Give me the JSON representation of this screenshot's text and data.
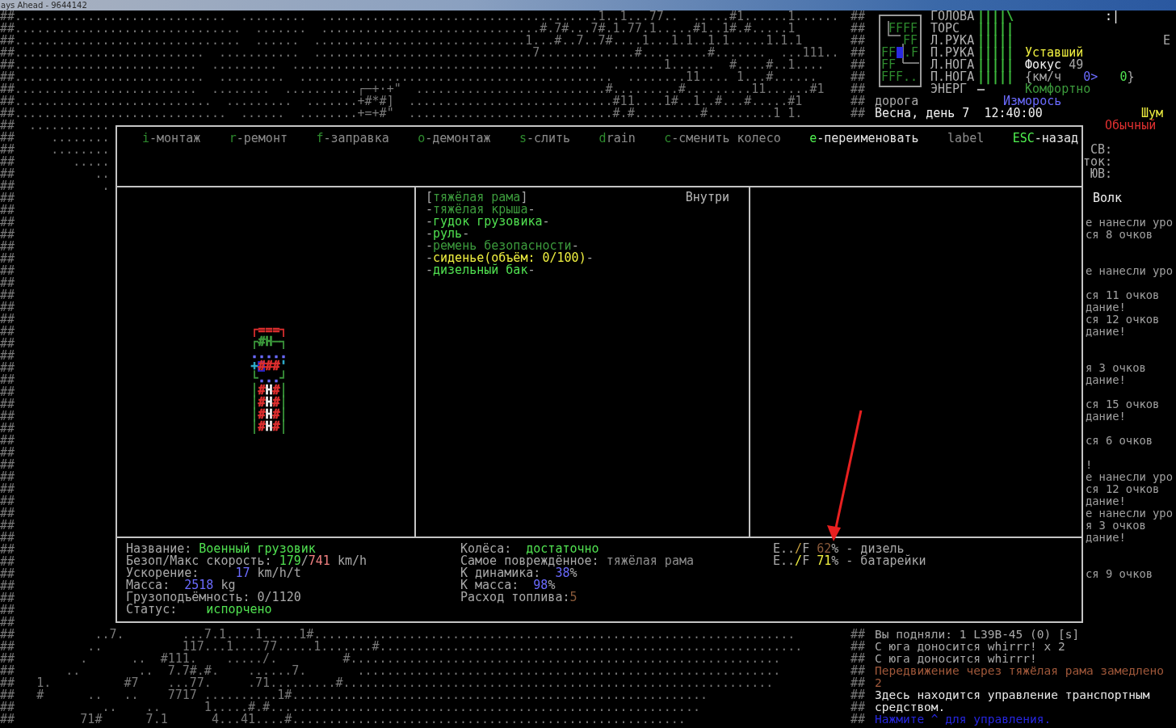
{
  "window": {
    "title": "ays Ahead - 9644142"
  },
  "map": {
    "top_rows": [
      {
        "text": "##.............................  .........  ......................................1..1...77..  .....#1......1......",
        "edge": "##"
      },
      {
        "text": "##...............................  .......  ..............................#.7#...7#.1.77.1.....#1..1#.#.....1",
        "edge": "##"
      },
      {
        "text": "##...............................  ......  .............................1...#..7..7#....1...1.1..1.1.....1.1.1",
        "edge": "##"
      },
      {
        "text": "##..........................  ...........  ..............................7.............#.........#.......  ...111..",
        "edge": "##"
      },
      {
        "text": "##.........................  .........  ..........................................  .......1......  #....#..1....",
        "edge": "##"
      },
      {
        "text": "##..........................  .........  ...........................................  ........11.... 1...#......",
        "edge": "##"
      },
      {
        "text": "##.........................  ........  ..........┌─+·+\"  ..........................#.........#.........11......#1",
        "edge": "##"
      },
      {
        "text": "##...........................  .........  .......+#*#]  ............................#11....1#..1..#...#.....#1",
        "edge": "##"
      },
      {
        "text": "##.............................  ......  ........+=+#\"  ............................#.#.........#.........1 1.",
        "edge": "##"
      }
    ],
    "side_rows": [
      "##  ...........",
      "##     ........",
      "##     ........",
      "##        .....",
      "##           ..",
      "##            .",
      "##",
      "##",
      "##",
      "##",
      "##",
      "##",
      "##",
      "##",
      "##",
      "##",
      "##",
      "##",
      "##",
      "##",
      "##",
      "##",
      "##",
      "##",
      "##",
      "##",
      "##",
      "##",
      "##",
      "##",
      "##",
      "##",
      "##",
      "##",
      "##",
      "##",
      "##",
      "##",
      "##",
      "##",
      "##",
      "##"
    ],
    "bottom_rows": [
      {
        "text": "##           ..7.        ...7.1....1.....1#..................................................................",
        "edge": "##"
      },
      {
        "text": "##          ..           117...1....77.....1.......#..........................................................",
        "edge": "##"
      },
      {
        "text": "##         .      ..  #111.    ...../.         #...........................................................",
        "edge": "##"
      },
      {
        "text": "##       ..        ..  7.7#.#.    ......7.       ..........................................................",
        "edge": "##"
      },
      {
        "text": "##   1.          #7    ...77.     .71.........#...........................................................",
        "edge": "##"
      },
      {
        "text": "##   #      ..   ..    7717 ..........1#.........................................................",
        "edge": "##"
      },
      {
        "text": "##            ..    ..      1.....#.#...........................................................",
        "edge": "##"
      },
      {
        "text": "##         71#      7.1      4...41....#......................................................",
        "edge": "##"
      }
    ]
  },
  "status": {
    "minimap": [
      {
        "text": "FFFF",
        "player": false
      },
      {
        "text": "FF",
        "player": false
      },
      {
        "text": "FF",
        "player": true,
        "after": ".F"
      },
      {
        "text": "FF",
        "player": false
      },
      {
        "text": "FFF..",
        "player": false
      }
    ],
    "face": ":|",
    "body_parts": [
      {
        "name": "ГОЛОВА",
        "bar": "||||\\",
        "color": "#3cb83c"
      },
      {
        "name": "ТОРС",
        "bar": "|||||",
        "color": "#3cb83c"
      },
      {
        "name": "Л.РУКА",
        "bar": "|||||",
        "color": "#3cb83c"
      },
      {
        "name": "П.РУКА",
        "bar": "|||||",
        "color": "#3cb83c"
      },
      {
        "name": "Л.НОГА",
        "bar": "|||||",
        "color": "#3cb83c"
      },
      {
        "name": "П.НОГА",
        "bar": "|||||",
        "color": "#3cb83c"
      },
      {
        "name": "ЭНЕРГ",
        "bar": "—",
        "color": "#a8a8a8"
      }
    ],
    "compass_east": "E",
    "mood": {
      "text": "Уставший",
      "color": "#f0f040"
    },
    "focus": {
      "label": "Фокус",
      "value": "49"
    },
    "speed": {
      "parts": [
        {
          "text": "{км/ч   ",
          "color": "#a8a8a8"
        },
        {
          "text": "0>",
          "color": "#6b6bff"
        },
        {
          "text": "   0",
          "color": "#50e050"
        },
        {
          "text": "}",
          "color": "#a8a8a8"
        }
      ]
    },
    "temperature": {
      "text": "Комфортно",
      "color": "#3c9a3c"
    },
    "terrain": "дорога",
    "weather": {
      "text": "Изморось",
      "color": "#6b6bff"
    },
    "date_time": "Весна, день 7  12:40:00",
    "noise": {
      "text": "Шум",
      "color": "#f0f040"
    },
    "stance": {
      "text": "Обычный",
      "color": "#e03030"
    },
    "wind_labels": [
      "СВ:",
      "ток:",
      "ЮВ:"
    ],
    "target": "Волк",
    "combat_log": [
      "е нанесли уро",
      "ся 8 очков",
      "е нанесли уро",
      "ся 11 очков",
      "дание!",
      "ся 12 очков",
      "дание!",
      "я 3 очков",
      "дание!",
      "ся 15 очков",
      "дание!",
      "ся 6 очков",
      "!",
      "е нанесли уро",
      "ся 12 очков",
      "дание!",
      "е нанесли уро",
      "я 3 очков",
      "дание!",
      "ся 9 очков"
    ]
  },
  "dialog": {
    "commands": [
      {
        "key": "i",
        "label": "-монтаж",
        "enabled": false
      },
      {
        "key": "r",
        "label": "-ремонт",
        "enabled": false
      },
      {
        "key": "f",
        "label": "-заправка",
        "enabled": false
      },
      {
        "key": "o",
        "label": "-демонтаж",
        "enabled": false
      },
      {
        "key": "s",
        "label": "-слить",
        "enabled": false
      },
      {
        "key": "d",
        "label": "rain",
        "enabled": false
      },
      {
        "key": "c",
        "label": "-сменить колесо",
        "enabled": false
      },
      {
        "key": "e",
        "label": "-переименовать",
        "enabled": true
      },
      {
        "label": "label",
        "enabled": false
      },
      {
        "key": "ESC",
        "label": "-назад",
        "enabled": true
      }
    ],
    "vehicle_drawing": [
      {
        "parts": [
          {
            "text": "┌===┐",
            "color": "#e03030"
          }
        ]
      },
      {
        "parts": [
          {
            "text": "┌#H─┐",
            "color": "#3c9a3c"
          }
        ]
      },
      {
        "parts": [
          {
            "text": ".....",
            "color": "#6b6bff"
          }
        ]
      },
      {
        "parts": [
          {
            "text": "+",
            "color": "#30b0d0",
            "highlight": false
          },
          {
            "text": "#",
            "color": "#e03030",
            "highlight": true
          },
          {
            "text": "##",
            "color": "#e03030",
            "highlight": false
          },
          {
            "text": "'",
            "color": "#30b0d0",
            "highlight": false
          }
        ]
      },
      {
        "parts": [
          {
            "text": "└",
            "color": "#3c9a3c"
          },
          {
            "text": "...",
            "color": "#6b6bff"
          },
          {
            "text": "┘",
            "color": "#3c9a3c"
          }
        ]
      },
      {
        "parts": [
          {
            "text": "│",
            "color": "#3c9a3c"
          },
          {
            "text": "#",
            "color": "#e03030"
          },
          {
            "text": "H",
            "color": "#f0f0f0"
          },
          {
            "text": "#",
            "color": "#e03030"
          },
          {
            "text": "│",
            "color": "#3c9a3c"
          }
        ]
      },
      {
        "parts": [
          {
            "text": "│",
            "color": "#3c9a3c"
          },
          {
            "text": "#",
            "color": "#e03030"
          },
          {
            "text": "H",
            "color": "#f0f0f0"
          },
          {
            "text": "#",
            "color": "#e03030"
          },
          {
            "text": "│",
            "color": "#3c9a3c"
          }
        ]
      },
      {
        "parts": [
          {
            "text": "│",
            "color": "#3c9a3c"
          },
          {
            "text": "#",
            "color": "#e03030"
          },
          {
            "text": "H",
            "color": "#f0f0f0"
          },
          {
            "text": "#",
            "color": "#e03030"
          },
          {
            "text": "│",
            "color": "#3c9a3c"
          }
        ]
      },
      {
        "parts": [
          {
            "text": "│",
            "color": "#3c9a3c"
          },
          {
            "text": "#",
            "color": "#e03030"
          },
          {
            "text": "H",
            "color": "#f0f0f0"
          },
          {
            "text": "#",
            "color": "#e03030"
          },
          {
            "text": "│",
            "color": "#3c9a3c"
          }
        ]
      }
    ],
    "parts": [
      {
        "parts": [
          {
            "text": "[",
            "color": "#a8a8a8"
          },
          {
            "text": "тяжёлая рама",
            "color": "#3c9a3c"
          },
          {
            "text": "]",
            "color": "#a8a8a8"
          }
        ]
      },
      {
        "parts": [
          {
            "text": "-",
            "color": "#a8a8a8"
          },
          {
            "text": "тяжёлая крыша",
            "color": "#3c9a3c"
          },
          {
            "text": "-",
            "color": "#a8a8a8"
          }
        ]
      },
      {
        "parts": [
          {
            "text": "-",
            "color": "#a8a8a8"
          },
          {
            "text": "гудок грузовика",
            "color": "#50e050"
          },
          {
            "text": "-",
            "color": "#a8a8a8"
          }
        ]
      },
      {
        "parts": [
          {
            "text": "-",
            "color": "#a8a8a8"
          },
          {
            "text": "руль",
            "color": "#50e050"
          },
          {
            "text": "-",
            "color": "#a8a8a8"
          }
        ]
      },
      {
        "parts": [
          {
            "text": "-",
            "color": "#a8a8a8"
          },
          {
            "text": "ремень безопасности",
            "color": "#3c9a3c"
          },
          {
            "text": "-",
            "color": "#a8a8a8"
          }
        ]
      },
      {
        "parts": [
          {
            "text": "-",
            "color": "#a8a8a8"
          },
          {
            "text": "сиденье(объём: 0/100)",
            "color": "#f0f040"
          },
          {
            "text": "-",
            "color": "#a8a8a8"
          }
        ]
      },
      {
        "parts": [
          {
            "text": "-",
            "color": "#a8a8a8"
          },
          {
            "text": "дизельный бак",
            "color": "#50e050"
          },
          {
            "text": "-",
            "color": "#a8a8a8"
          }
        ]
      }
    ],
    "location_label": "Внутри",
    "info_columns": [
      [
        {
          "parts": [
            {
              "text": "Название: ",
              "color": "#a8a8a8"
            },
            {
              "text": "Военный грузовик",
              "color": "#50e050"
            }
          ]
        },
        {
          "parts": [
            {
              "text": "Безоп/Макс скорость: ",
              "color": "#a8a8a8"
            },
            {
              "text": "179",
              "color": "#50e050"
            },
            {
              "text": "/",
              "color": "#a8a8a8"
            },
            {
              "text": "741",
              "color": "#f08080"
            },
            {
              "text": " km/h",
              "color": "#a8a8a8"
            }
          ]
        },
        {
          "parts": [
            {
              "text": "Ускорение:     ",
              "color": "#a8a8a8"
            },
            {
              "text": "17",
              "color": "#6b6bff"
            },
            {
              "text": " km/h/t",
              "color": "#a8a8a8"
            }
          ]
        },
        {
          "parts": [
            {
              "text": "Масса:  ",
              "color": "#a8a8a8"
            },
            {
              "text": "2518",
              "color": "#6b6bff"
            },
            {
              "text": " kg",
              "color": "#a8a8a8"
            }
          ]
        },
        {
          "parts": [
            {
              "text": "Грузоподъёмность: 0/1120",
              "color": "#a8a8a8"
            }
          ]
        },
        {
          "parts": [
            {
              "text": "Статус:    ",
              "color": "#a8a8a8"
            },
            {
              "text": "испорчено",
              "color": "#50e050"
            }
          ]
        }
      ],
      [
        {
          "parts": [
            {
              "text": "Колёса:  ",
              "color": "#a8a8a8"
            },
            {
              "text": "достаточно",
              "color": "#50e050"
            }
          ]
        },
        {
          "parts": [
            {
              "text": "Самое повреждённое: ",
              "color": "#a8a8a8"
            },
            {
              "text": "тяжёлая рама",
              "color": "#8c8c8c"
            }
          ]
        },
        {
          "parts": [
            {
              "text": "К динамика:  ",
              "color": "#a8a8a8"
            },
            {
              "text": "38",
              "color": "#6b6bff"
            },
            {
              "text": "%",
              "color": "#a8a8a8"
            }
          ]
        },
        {
          "parts": [
            {
              "text": "К масса:  ",
              "color": "#a8a8a8"
            },
            {
              "text": "98",
              "color": "#6b6bff"
            },
            {
              "text": "%",
              "color": "#a8a8a8"
            }
          ]
        },
        {
          "parts": [
            {
              "text": "Расход топлива:",
              "color": "#a8a8a8"
            },
            {
              "text": "5",
              "color": "#8a5a3a"
            }
          ]
        }
      ],
      [
        {
          "parts": [
            {
              "text": "E..",
              "color": "#a8a8a8"
            },
            {
              "text": "/",
              "color": "#c8a040"
            },
            {
              "text": "F ",
              "color": "#a8a8a8"
            },
            {
              "text": "62",
              "color": "#8a5a3a"
            },
            {
              "text": "% - дизель",
              "color": "#a8a8a8"
            }
          ]
        },
        {
          "parts": [
            {
              "text": "E..",
              "color": "#a8a8a8"
            },
            {
              "text": "/",
              "color": "#f0f040"
            },
            {
              "text": "F ",
              "color": "#a8a8a8"
            },
            {
              "text": "71",
              "color": "#f0f040"
            },
            {
              "text": "% - батарейки",
              "color": "#a8a8a8"
            }
          ]
        }
      ]
    ]
  },
  "messages": [
    {
      "text": "Вы подняли: 1 L39B-45 (0) [s]",
      "color": "#a8a8a8"
    },
    {
      "text": "С юга доносится whirrr! x 2",
      "color": "#a8a8a8"
    },
    {
      "text": "С юга доносится whirrr!",
      "color": "#a8a8a8"
    },
    {
      "text": "Передвижение через тяжёлая рама замедлено",
      "color": "#a0583a"
    },
    {
      "text": "2",
      "color": "#a0583a"
    },
    {
      "text": "Здесь находится управление транспортным",
      "color": "#e8e8e8"
    },
    {
      "text": "средством.",
      "color": "#e8e8e8"
    },
    {
      "text": "Нажмите ^ для управления.",
      "color": "#2626e0"
    }
  ]
}
